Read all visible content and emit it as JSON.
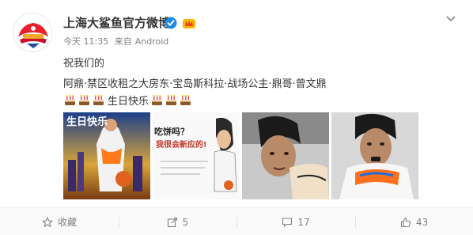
{
  "post": {
    "author": "上海大鲨鱼官方微博",
    "time": "今天 11:35",
    "source_prefix": "来自",
    "source": "Android",
    "line1": "祝我们的",
    "line2": "阿鼎·禁区收租之大房东·宝岛斯科拉·战场公主·鼎哥·曾文鼎",
    "birthday_text": "生日快乐"
  },
  "images": {
    "poster1_caption": "生日快乐",
    "poster2_headline1": "吃饼吗？",
    "poster2_headline2": "我很会新应的!"
  },
  "actions": {
    "favorite_label": "收藏",
    "share_count": "5",
    "comment_count": "17",
    "like_count": "43"
  },
  "colors": {
    "accent": "#ff8200",
    "text": "#333333",
    "meta": "#808080",
    "verified": "#1f8ae2"
  },
  "icons": {
    "more": "chevron-down-icon",
    "favorite": "star-icon",
    "share": "share-icon",
    "comment": "comment-icon",
    "like": "thumbs-up-icon",
    "cake": "birthday-cake-icon"
  }
}
